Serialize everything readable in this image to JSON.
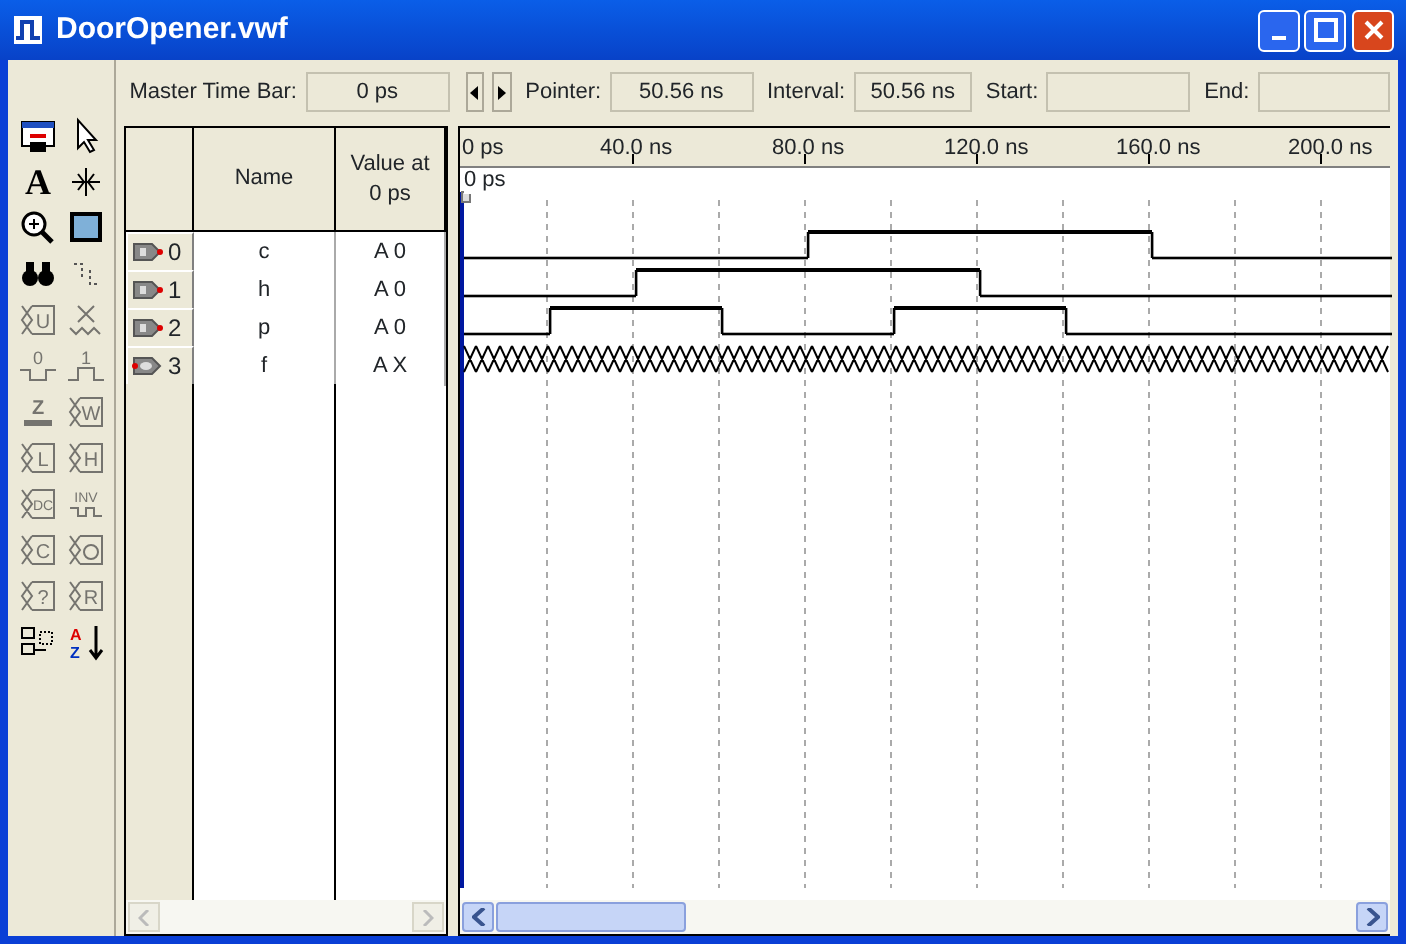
{
  "window": {
    "title": "DoorOpener.vwf"
  },
  "tools": [
    {
      "kind": "editor",
      "disabled": false
    },
    {
      "kind": "select",
      "disabled": false
    },
    {
      "kind": "text",
      "glyph": "A",
      "disabled": false
    },
    {
      "kind": "snap",
      "disabled": false
    },
    {
      "kind": "zoom",
      "disabled": false
    },
    {
      "kind": "fullscreen",
      "disabled": false
    },
    {
      "kind": "find",
      "disabled": false
    },
    {
      "kind": "replace",
      "disabled": false
    },
    {
      "kind": "value",
      "glyph": "U",
      "disabled": true
    },
    {
      "kind": "unknown",
      "disabled": true
    },
    {
      "kind": "low",
      "glyph": "0",
      "disabled": true
    },
    {
      "kind": "high",
      "glyph": "1",
      "disabled": true
    },
    {
      "kind": "z",
      "glyph": "Z",
      "disabled": true
    },
    {
      "kind": "value",
      "glyph": "W",
      "disabled": true
    },
    {
      "kind": "value",
      "glyph": "L",
      "disabled": true
    },
    {
      "kind": "value",
      "glyph": "H",
      "disabled": true
    },
    {
      "kind": "value",
      "glyph": "DC",
      "disabled": true
    },
    {
      "kind": "invert",
      "glyph": "INV",
      "disabled": true
    },
    {
      "kind": "value",
      "glyph": "C",
      "disabled": true
    },
    {
      "kind": "clock",
      "disabled": true
    },
    {
      "kind": "value",
      "glyph": "?",
      "disabled": true
    },
    {
      "kind": "value",
      "glyph": "R",
      "disabled": true
    },
    {
      "kind": "group",
      "disabled": false
    },
    {
      "kind": "sort",
      "glyph": "AZ",
      "disabled": false
    }
  ],
  "time_fields": [
    {
      "label": "Master Time Bar:",
      "value": "0 ps"
    },
    {
      "label": "Pointer:",
      "value": "50.56 ns"
    },
    {
      "label": "Interval:",
      "value": "50.56 ns"
    },
    {
      "label": "Start:"
    },
    {
      "label": "End:"
    }
  ],
  "columns": [
    "Name",
    "Value at 0 ps"
  ],
  "ruler": [
    "0 ps",
    "40.0 ns",
    "80.0 ns",
    "120.0 ns",
    "160.0 ns",
    "200.0 ns"
  ],
  "cursor": {
    "label": "0 ps"
  },
  "signals": [
    {
      "index": "0",
      "kind": "input",
      "name": "c",
      "value": "A 0",
      "unknown": false,
      "high": [
        false,
        false,
        false,
        false,
        true,
        true,
        true,
        true,
        false,
        false,
        false
      ]
    },
    {
      "index": "1",
      "kind": "input",
      "name": "h",
      "value": "A 0",
      "unknown": false,
      "high": [
        false,
        false,
        true,
        true,
        true,
        true,
        false,
        false,
        false,
        false,
        false
      ]
    },
    {
      "index": "2",
      "kind": "input",
      "name": "p",
      "value": "A 0",
      "unknown": false,
      "high": [
        false,
        true,
        true,
        false,
        false,
        true,
        true,
        false,
        false,
        false,
        false
      ]
    },
    {
      "index": "3",
      "kind": "output",
      "name": "f",
      "value": "A X",
      "unknown": true
    }
  ]
}
